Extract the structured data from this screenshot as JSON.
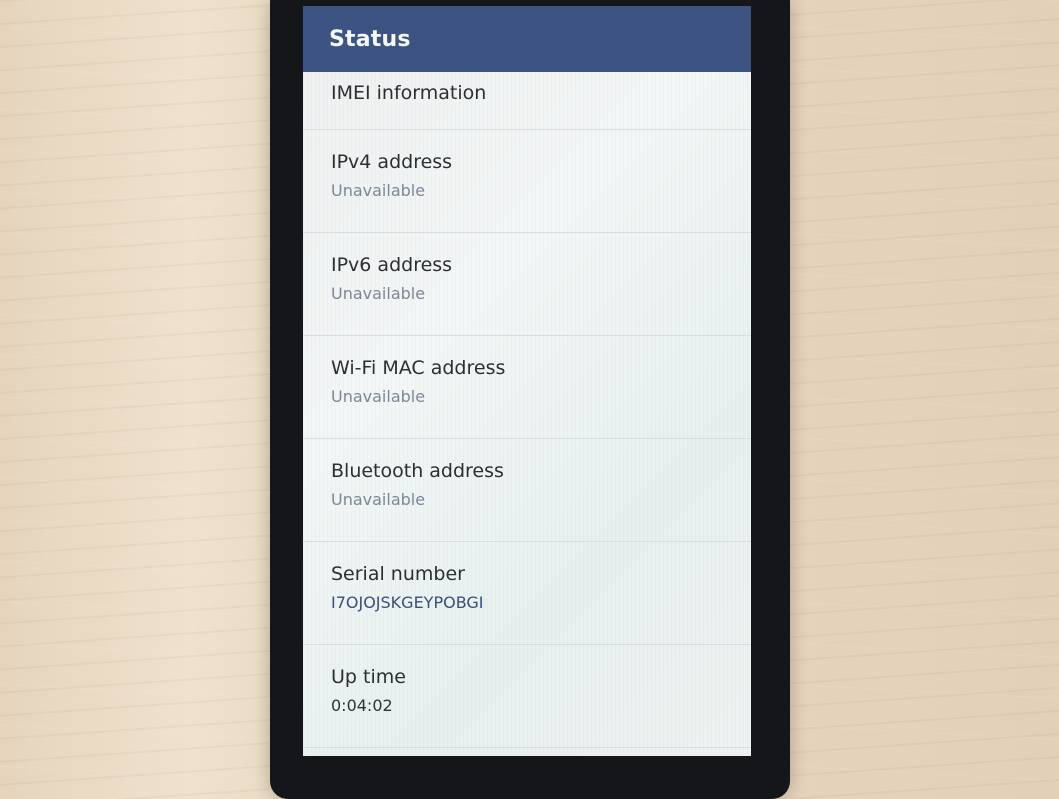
{
  "header": {
    "title": "Status"
  },
  "items": [
    {
      "title": "IMEI information",
      "summary": ""
    },
    {
      "title": "IPv4 address",
      "summary": "Unavailable"
    },
    {
      "title": "IPv6 address",
      "summary": "Unavailable"
    },
    {
      "title": "Wi-Fi MAC address",
      "summary": "Unavailable"
    },
    {
      "title": "Bluetooth address",
      "summary": "Unavailable"
    },
    {
      "title": "Serial number",
      "summary": "I7OJOJSKGEYPOBGI"
    },
    {
      "title": "Up time",
      "summary": "0:04:02"
    }
  ],
  "colors": {
    "top_bar": "#3d5381",
    "title_text": "#2b2f33",
    "summary_text": "#7b8896",
    "accent_text": "#394e7a"
  }
}
